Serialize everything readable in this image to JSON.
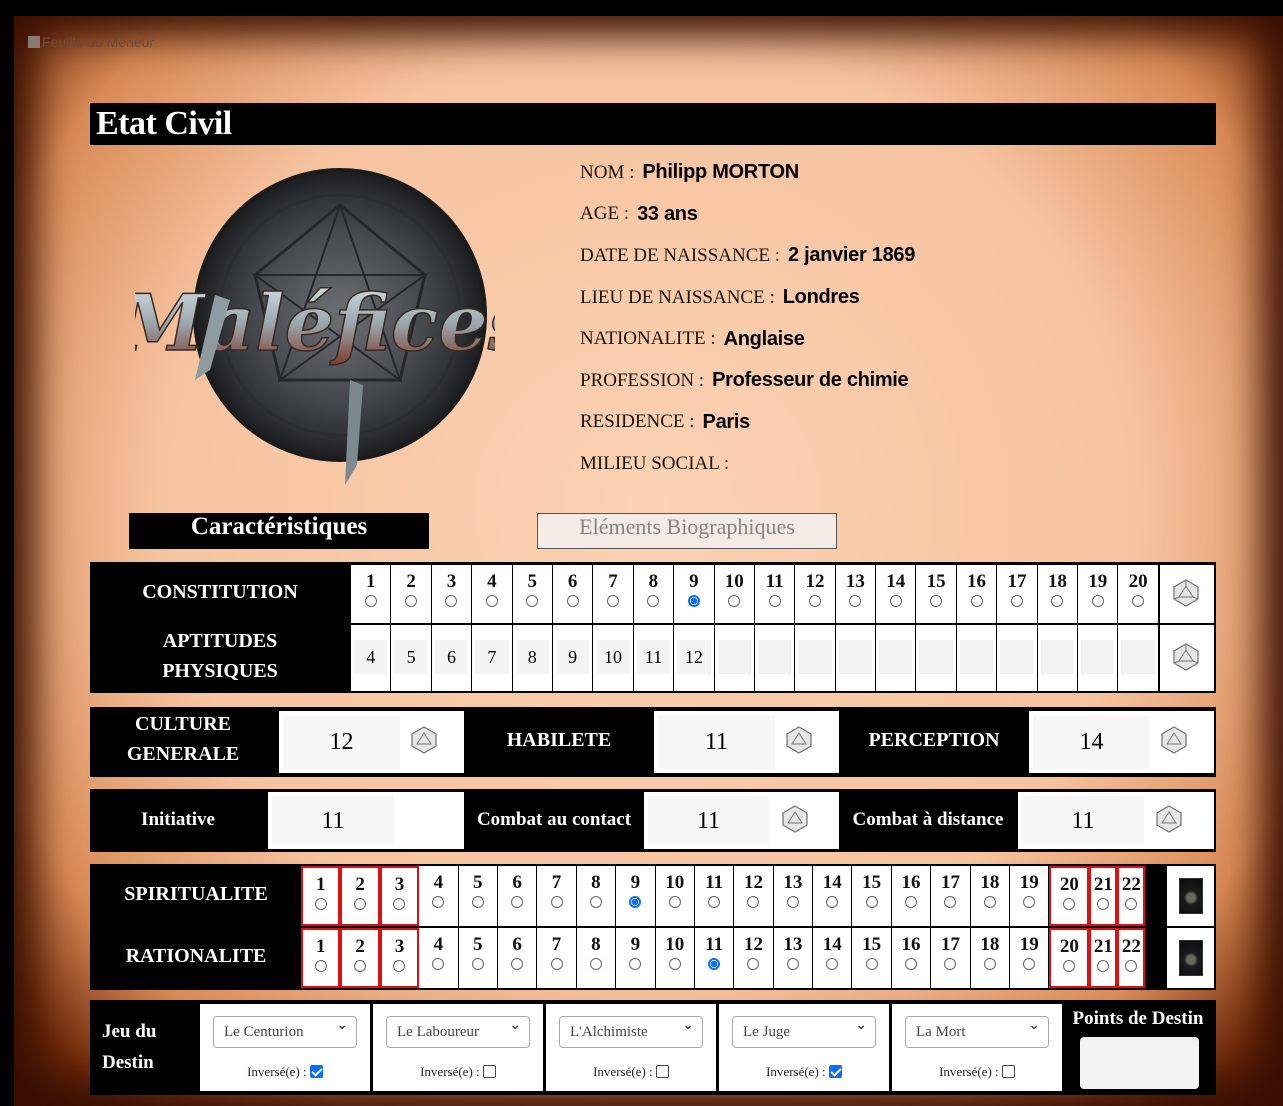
{
  "window_label": "Feuille du Meneur",
  "etat_civil": {
    "title": "Etat Civil",
    "fields": [
      {
        "label": "NOM :",
        "value": "Philipp MORTON"
      },
      {
        "label": "AGE :",
        "value": "33 ans"
      },
      {
        "label": "DATE DE NAISSANCE :",
        "value": "2 janvier 1869"
      },
      {
        "label": "LIEU DE NAISSANCE :",
        "value": "Londres"
      },
      {
        "label": "NATIONALITE :",
        "value": "Anglaise"
      },
      {
        "label": "PROFESSION :",
        "value": "Professeur de chimie"
      },
      {
        "label": "RESIDENCE :",
        "value": "Paris"
      },
      {
        "label": "MILIEU SOCIAL :",
        "value": ""
      }
    ],
    "logo_text": "Maléfices"
  },
  "tabs": {
    "active": "Caractéristiques",
    "inactive": "Eléments Biographiques"
  },
  "constitution": {
    "label": "CONSTITUTION",
    "numbers": [
      "1",
      "2",
      "3",
      "4",
      "5",
      "6",
      "7",
      "8",
      "9",
      "10",
      "11",
      "12",
      "13",
      "14",
      "15",
      "16",
      "17",
      "18",
      "19",
      "20"
    ],
    "selected": "9"
  },
  "aptitudes": {
    "label_line1": "APTITUDES",
    "label_line2": "PHYSIQUES",
    "values": [
      "4",
      "5",
      "6",
      "7",
      "8",
      "9",
      "10",
      "11",
      "12",
      "",
      "",
      "",
      "",
      "",
      "",
      "",
      "",
      "",
      "",
      ""
    ]
  },
  "stats_row1": {
    "culture_line1": "CULTURE",
    "culture_line2": "GENERALE",
    "culture_value": "12",
    "habilete_label": "HABILETE",
    "habilete_value": "11",
    "perception_label": "PERCEPTION",
    "perception_value": "14"
  },
  "stats_row2": {
    "initiative_label": "Initiative",
    "initiative_value": "11",
    "contact_label": "Combat au contact",
    "contact_value": "11",
    "distance_label": "Combat à distance",
    "distance_value": "11"
  },
  "spiritualite": {
    "label": "SPIRITUALITE",
    "numbers": [
      "1",
      "2",
      "3",
      "4",
      "5",
      "6",
      "7",
      "8",
      "9",
      "10",
      "11",
      "12",
      "13",
      "14",
      "15",
      "16",
      "17",
      "18",
      "19",
      "20",
      "21",
      "22"
    ],
    "selected": "9"
  },
  "rationalite": {
    "label": "RATIONALITE",
    "numbers": [
      "1",
      "2",
      "3",
      "4",
      "5",
      "6",
      "7",
      "8",
      "9",
      "10",
      "11",
      "12",
      "13",
      "14",
      "15",
      "16",
      "17",
      "18",
      "19",
      "20",
      "21",
      "22"
    ],
    "selected": "11"
  },
  "jeu_du_destin": {
    "label_line1": "Jeu du",
    "label_line2": "Destin",
    "inverse_label": "Inversé(e) :",
    "cards": [
      {
        "name": "Le Centurion",
        "inverse": true
      },
      {
        "name": "Le Laboureur",
        "inverse": false
      },
      {
        "name": "L'Alchimiste",
        "inverse": false
      },
      {
        "name": "Le Juge",
        "inverse": true
      },
      {
        "name": "La Mort",
        "inverse": false
      }
    ],
    "points_label": "Points de Destin",
    "points_value": ""
  },
  "colors": {
    "accent": "#0b6efd",
    "red_border": "#e01010",
    "parchment": "#f6c39f"
  }
}
